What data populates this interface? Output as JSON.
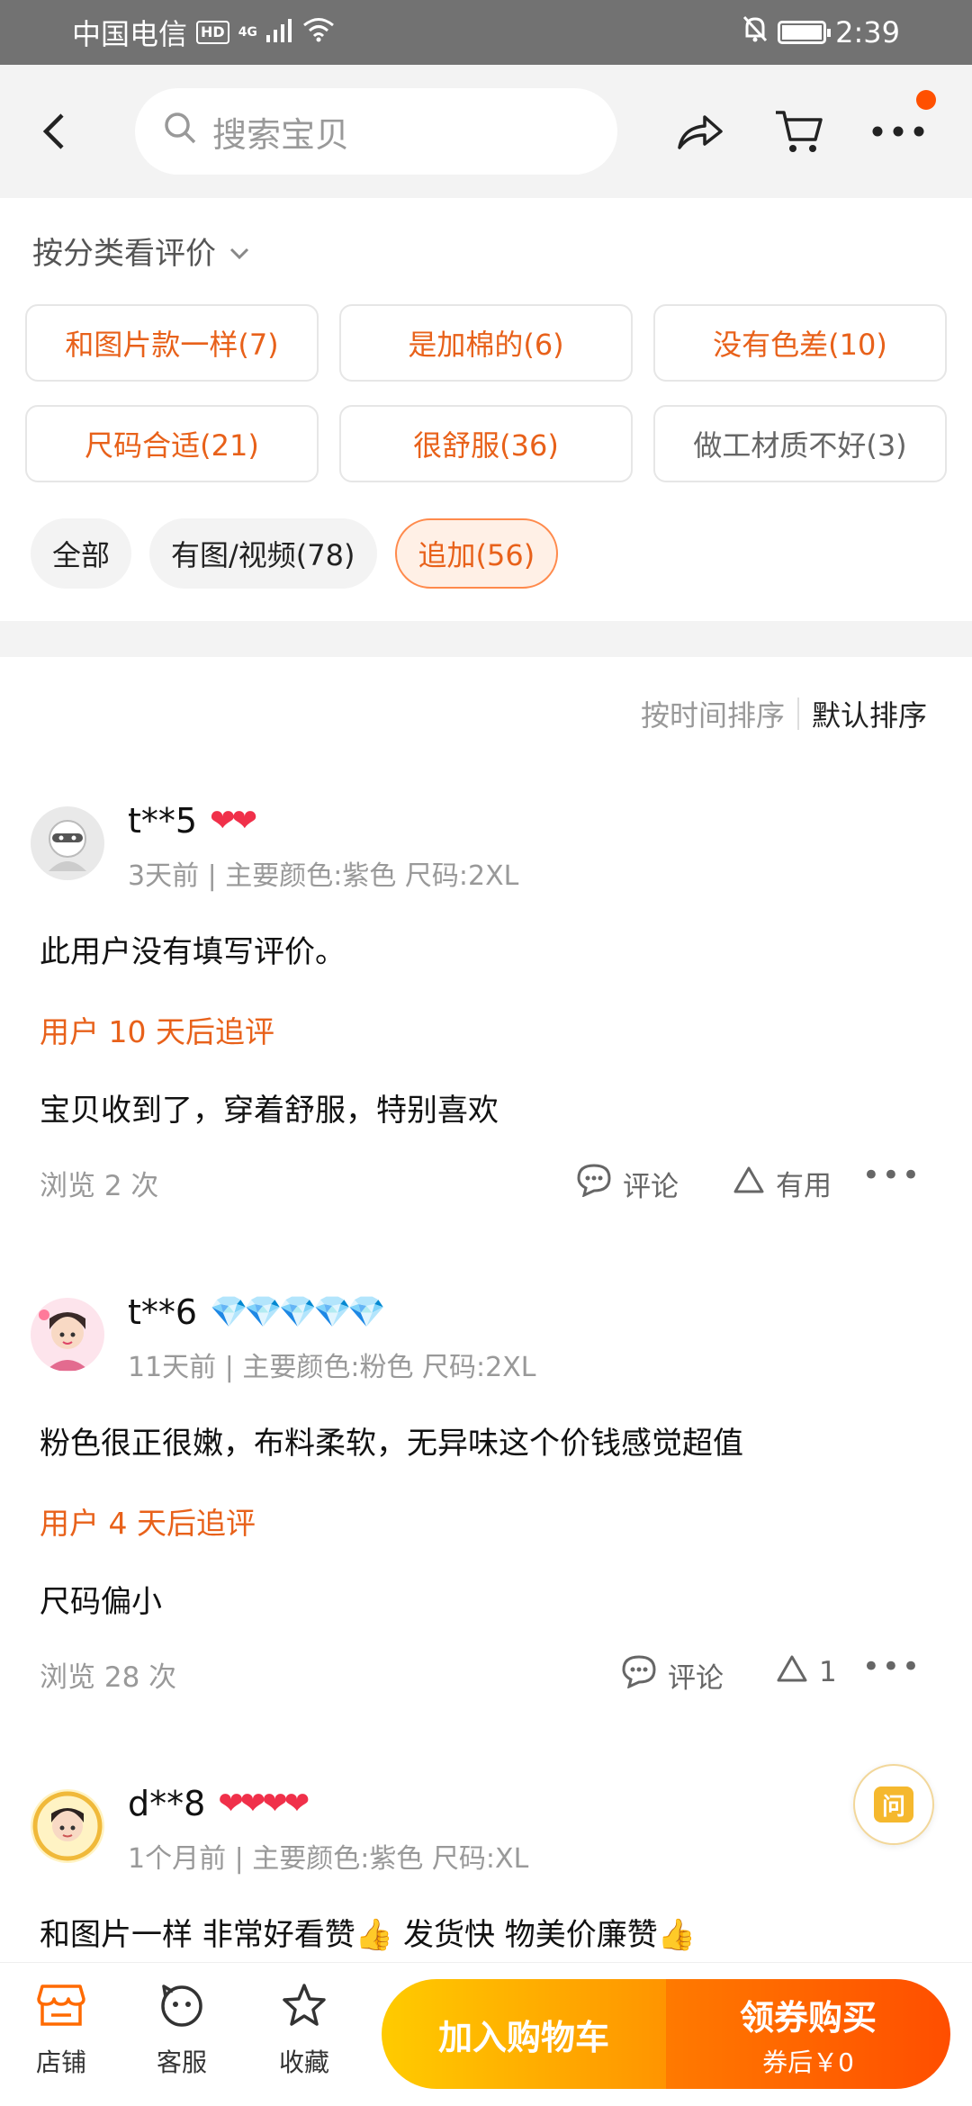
{
  "status_bar": {
    "carrier": "中国电信",
    "hd_badge": "HD",
    "net": "4G",
    "time": "2:39"
  },
  "top_nav": {
    "search_placeholder": "搜索宝贝",
    "icons": [
      "back-icon",
      "search-icon",
      "share-icon",
      "cart-icon",
      "more-icon"
    ]
  },
  "filters": {
    "heading": "按分类看评价",
    "tags": [
      {
        "label": "和图片款一样(7)",
        "sentiment": "positive"
      },
      {
        "label": "是加棉的(6)",
        "sentiment": "positive"
      },
      {
        "label": "没有色差(10)",
        "sentiment": "positive"
      },
      {
        "label": "尺码合适(21)",
        "sentiment": "positive"
      },
      {
        "label": "很舒服(36)",
        "sentiment": "positive"
      },
      {
        "label": "做工材质不好(3)",
        "sentiment": "negative"
      }
    ],
    "chips": [
      {
        "label": "全部",
        "active": false
      },
      {
        "label": "有图/视频(78)",
        "active": false
      },
      {
        "label": "追加(56)",
        "active": true
      }
    ]
  },
  "sort": {
    "by_time": "按时间排序",
    "default": "默认排序"
  },
  "reviews": [
    {
      "user": "t**5",
      "level": "❤❤",
      "meta": "3天前 | 主要颜色:紫色 尺码:2XL",
      "text": "此用户没有填写评价。",
      "followup_label": "用户 10 天后追评",
      "followup_text": "宝贝收到了，穿着舒服，特别喜欢",
      "views": "浏览 2 次",
      "comment_label": "评论",
      "useful_label": "有用"
    },
    {
      "user": "t**6",
      "level": "💎💎💎💎💎",
      "meta": "11天前 | 主要颜色:粉色 尺码:2XL",
      "text": "粉色很正很嫩，布料柔软，无异味这个价钱感觉超值",
      "followup_label": "用户 4 天后追评",
      "followup_text": "尺码偏小",
      "views": "浏览 28 次",
      "comment_label": "评论",
      "useful_label": "1"
    },
    {
      "user": "d**8",
      "level": "❤❤❤❤",
      "meta": "1个月前 | 主要颜色:紫色 尺码:XL",
      "text": "和图片一样 非常好看赞👍 发货快  物美价廉赞👍"
    }
  ],
  "qa_float": {
    "label": "问"
  },
  "bottom_bar": {
    "tabs": [
      {
        "label": "店铺",
        "icon": "store-icon"
      },
      {
        "label": "客服",
        "icon": "customer-service-icon"
      },
      {
        "label": "收藏",
        "icon": "star-icon"
      }
    ],
    "add_to_cart": "加入购物车",
    "buy_line1": "领券购买",
    "buy_line2": "券后￥0"
  },
  "colors": {
    "accent": "#e8611a",
    "cart_button": "#ffb300",
    "buy_button": "#ff5a00"
  }
}
